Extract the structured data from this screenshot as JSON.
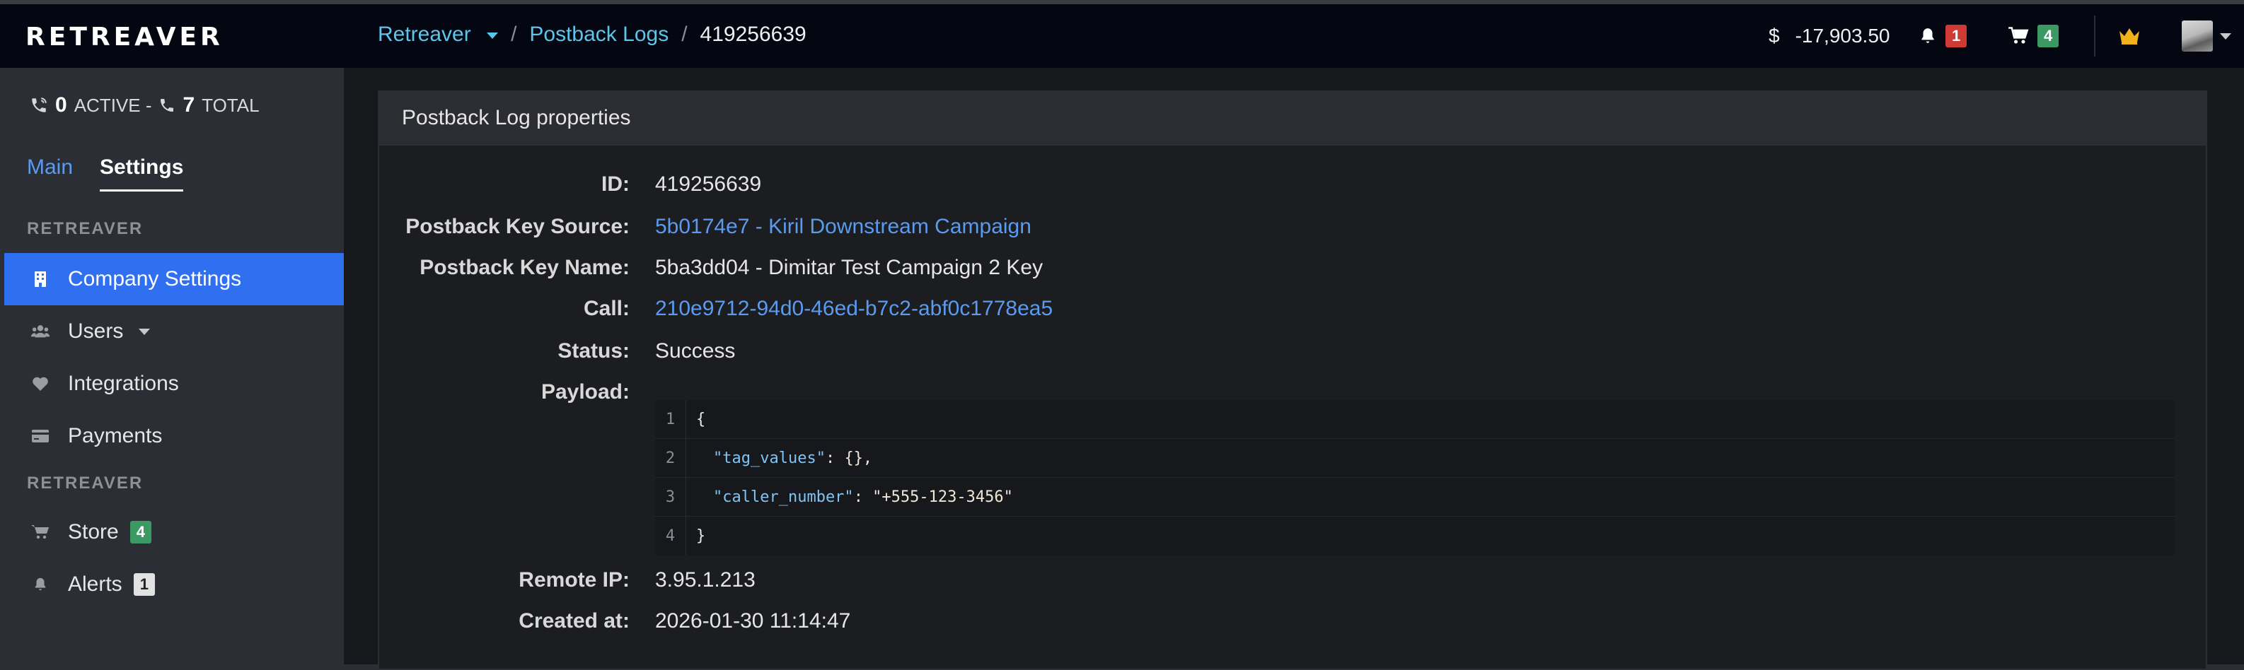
{
  "brand": {
    "logo_text": "RETREAVER"
  },
  "breadcrumb": {
    "root": "Retreaver",
    "section": "Postback Logs",
    "current": "419256639",
    "separator": "/"
  },
  "navbar": {
    "currency_symbol": "$",
    "balance": "-17,903.50",
    "notifications_count": "1",
    "cart_count": "4"
  },
  "sidebar": {
    "active_count": "0",
    "active_label": "ACTIVE -",
    "total_count": "7",
    "total_label": "TOTAL",
    "tabs": [
      {
        "label": "Main",
        "active": false
      },
      {
        "label": "Settings",
        "active": true
      }
    ],
    "sections": [
      {
        "label": "RETREAVER",
        "items": [
          {
            "label": "Company Settings",
            "icon": "building-icon",
            "active": true
          },
          {
            "label": "Users",
            "icon": "users-icon",
            "active": false
          },
          {
            "label": "Integrations",
            "icon": "heart-icon",
            "active": false
          },
          {
            "label": "Payments",
            "icon": "credit-card-icon",
            "active": false
          }
        ]
      },
      {
        "label": "RETREAVER",
        "items": [
          {
            "label": "Store",
            "icon": "cart-icon",
            "badge": "4"
          },
          {
            "label": "Alerts",
            "icon": "bell-icon",
            "badge": "1"
          }
        ]
      }
    ]
  },
  "panel": {
    "title": "Postback Log properties",
    "properties": {
      "id_label": "ID:",
      "id_value": "419256639",
      "key_source_label": "Postback Key Source:",
      "key_source_value": "5b0174e7 - Kiril Downstream Campaign",
      "key_name_label": "Postback Key Name:",
      "key_name_value": "5ba3dd04 - Dimitar Test Campaign 2 Key",
      "call_label": "Call:",
      "call_value": "210e9712-94d0-46ed-b7c2-abf0c1778ea5",
      "status_label": "Status:",
      "status_value": "Success",
      "payload_label": "Payload:",
      "remote_ip_label": "Remote IP:",
      "remote_ip_value": "3.95.1.213",
      "created_label": "Created at:",
      "created_value": "2026-01-30 11:14:47"
    },
    "payload": {
      "line_numbers": [
        "1",
        "2",
        "3",
        "4"
      ],
      "open_brace": "{",
      "key1": "\"tag_values\"",
      "rest1": ": {},",
      "key2": "\"caller_number\"",
      "rest2": ": \"+555-123-3456\"",
      "close_brace": "}"
    }
  },
  "colors": {
    "navbar_bg": "#040612",
    "accent_link": "#5a9bf0",
    "breadcrumb_link": "#5cc6ea",
    "active_menu": "#2f6ff0",
    "badge_red": "#d03a34",
    "badge_green": "#3b9a63"
  }
}
